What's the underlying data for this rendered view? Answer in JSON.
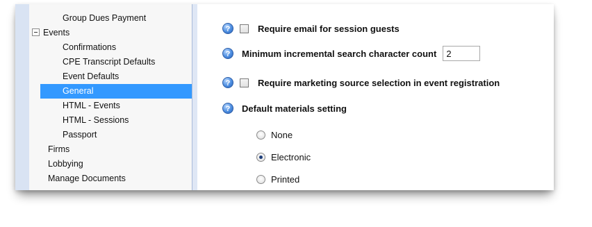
{
  "sidebar": {
    "items": [
      {
        "label": "Group Dues Payment"
      },
      {
        "label": "Events"
      },
      {
        "label": "Confirmations"
      },
      {
        "label": "CPE Transcript Defaults"
      },
      {
        "label": "Event Defaults"
      },
      {
        "label": "General"
      },
      {
        "label": "HTML - Events"
      },
      {
        "label": "HTML - Sessions"
      },
      {
        "label": "Passport"
      },
      {
        "label": "Firms"
      },
      {
        "label": "Lobbying"
      },
      {
        "label": "Manage Documents"
      }
    ],
    "selected": "General"
  },
  "settings": {
    "require_email": {
      "label": "Require email for session guests",
      "checked": false
    },
    "min_search_count": {
      "label": "Minimum incremental search character count",
      "value": "2"
    },
    "require_marketing": {
      "label": "Require marketing source selection in event registration",
      "checked": false
    },
    "default_materials": {
      "label": "Default materials setting",
      "options": [
        {
          "label": "None",
          "checked": false
        },
        {
          "label": "Electronic",
          "checked": true
        },
        {
          "label": "Printed",
          "checked": false
        }
      ]
    },
    "help_glyph": "?"
  },
  "colors": {
    "selection": "#3399ff",
    "help": "#4c8de0"
  }
}
